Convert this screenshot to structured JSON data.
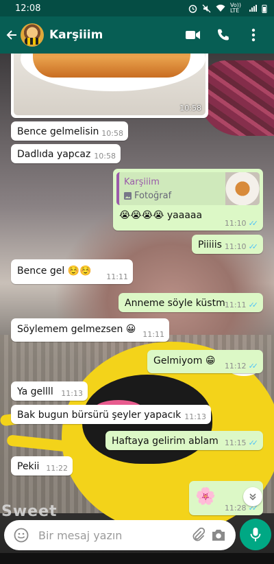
{
  "status_bar": {
    "time": "12:08",
    "network": "Vo)) LTE"
  },
  "header": {
    "contact_name": "Karşiiim"
  },
  "messages": [
    {
      "dir": "in",
      "kind": "image",
      "time": "10:58"
    },
    {
      "dir": "in",
      "text": "Bence gelmelisin",
      "time": "10:58"
    },
    {
      "dir": "in",
      "text": "Dadlıda yapcaz",
      "time": "10:58"
    },
    {
      "dir": "out",
      "kind": "reply",
      "quote_name": "Karşiiim",
      "quote_type": "Fotoğraf",
      "text": "😭😭😭😭 yaaaaa",
      "time": "11:10"
    },
    {
      "dir": "out",
      "text": "Piiiiis",
      "time": "11:10"
    },
    {
      "dir": "in",
      "text": "Bence gel ☺️☺️",
      "time": "11:11"
    },
    {
      "dir": "out",
      "text": "Anneme söyle küstm",
      "time": "11:11"
    },
    {
      "dir": "in",
      "text": "Söylemem gelmezsen 😀",
      "time": "11:11"
    },
    {
      "dir": "out",
      "text": "Gelmiyom 😁",
      "time": "11:12"
    },
    {
      "dir": "in",
      "text": "Ya gellll",
      "time": "11:13"
    },
    {
      "dir": "in",
      "text": "Bak bugun bürsürü şeyler yapacık",
      "time": "11:13"
    },
    {
      "dir": "out",
      "text": "Haftaya gelirim ablam",
      "time": "11:15"
    },
    {
      "dir": "in",
      "text": "Pekii",
      "time": "11:22"
    },
    {
      "dir": "out",
      "text": "🌸",
      "time": "11:28"
    }
  ],
  "wallpaper_text": "Sweet",
  "composer": {
    "placeholder": "Bir mesaj yazın"
  },
  "colors": {
    "header": "#075e54",
    "status": "#054d44",
    "outgoing": "#dcf8c6",
    "incoming": "#ffffff",
    "read_tick": "#4fc3f7",
    "mic": "#00a884"
  }
}
